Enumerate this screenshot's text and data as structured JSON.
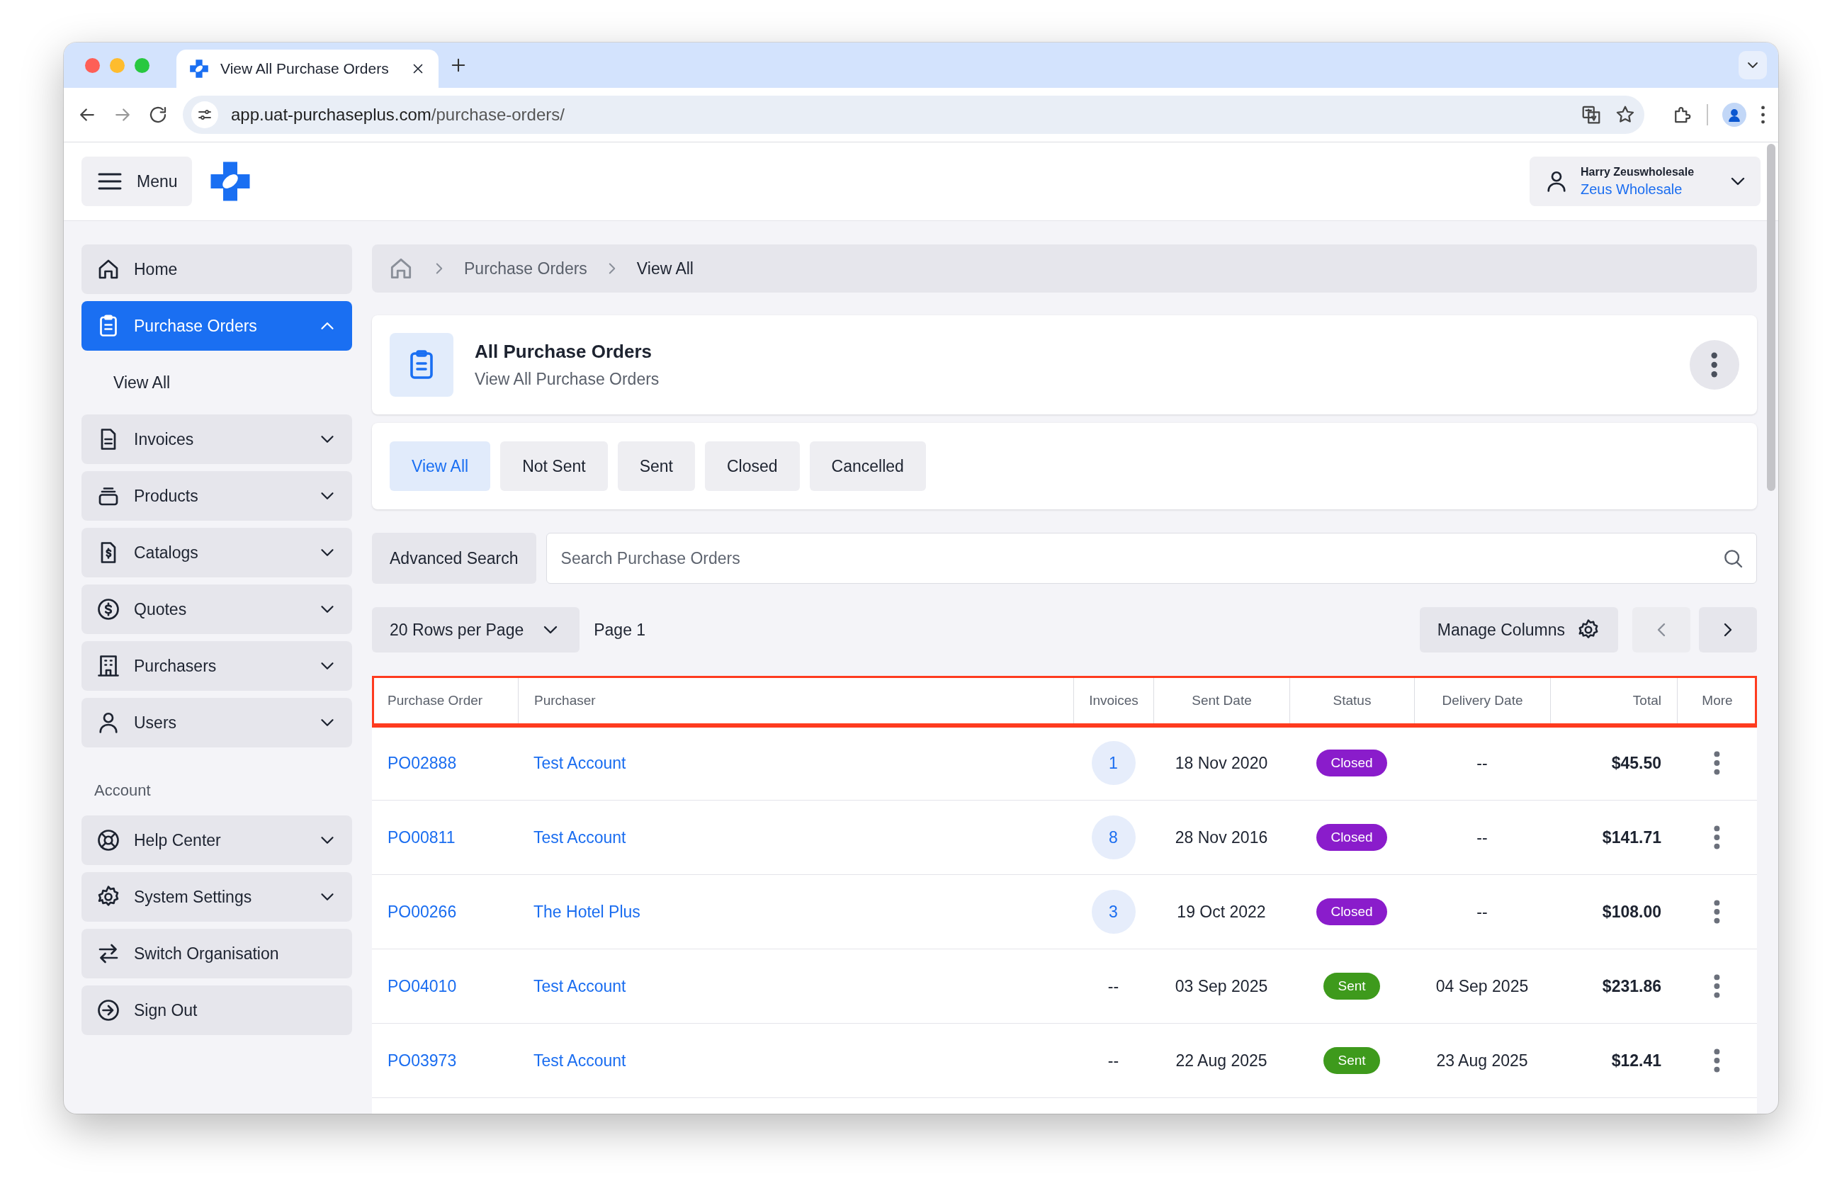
{
  "browser": {
    "tab_title": "View All Purchase Orders",
    "url_host": "app.uat-purchaseplus.com",
    "url_path": "/purchase-orders/"
  },
  "header": {
    "menu_label": "Menu",
    "user_name": "Harry Zeuswholesale",
    "organisation": "Zeus Wholesale"
  },
  "sidebar": {
    "items": [
      {
        "label": "Home",
        "kind": "link",
        "selected": false
      },
      {
        "label": "Purchase Orders",
        "kind": "group",
        "selected": true,
        "expanded": true,
        "children": [
          {
            "label": "View All"
          }
        ]
      },
      {
        "label": "Invoices",
        "kind": "group",
        "selected": false,
        "expanded": false
      },
      {
        "label": "Products",
        "kind": "group",
        "selected": false,
        "expanded": false
      },
      {
        "label": "Catalogs",
        "kind": "group",
        "selected": false,
        "expanded": false
      },
      {
        "label": "Quotes",
        "kind": "group",
        "selected": false,
        "expanded": false
      },
      {
        "label": "Purchasers",
        "kind": "group",
        "selected": false,
        "expanded": false
      },
      {
        "label": "Users",
        "kind": "group",
        "selected": false,
        "expanded": false
      }
    ],
    "section_label": "Account",
    "account_items": [
      {
        "label": "Help Center",
        "kind": "group",
        "selected": false,
        "expanded": false
      },
      {
        "label": "System Settings",
        "kind": "group",
        "selected": false,
        "expanded": false
      },
      {
        "label": "Switch Organisation",
        "kind": "link",
        "selected": false
      },
      {
        "label": "Sign Out",
        "kind": "link",
        "selected": false
      }
    ]
  },
  "breadcrumb": [
    "Purchase Orders",
    "View All"
  ],
  "page_header": {
    "title": "All Purchase Orders",
    "subtitle": "View All Purchase Orders"
  },
  "filter_tabs": [
    {
      "label": "View All",
      "selected": true
    },
    {
      "label": "Not Sent",
      "selected": false
    },
    {
      "label": "Sent",
      "selected": false
    },
    {
      "label": "Closed",
      "selected": false
    },
    {
      "label": "Cancelled",
      "selected": false
    }
  ],
  "search": {
    "button": "Advanced Search",
    "placeholder": "Search Purchase Orders"
  },
  "toolbar": {
    "rows_per_page": "20 Rows per Page",
    "page": "Page 1",
    "manage_columns": "Manage Columns",
    "prev_disabled": true
  },
  "table": {
    "highlighted": true,
    "columns": [
      "Purchase Order",
      "Purchaser",
      "Invoices",
      "Sent Date",
      "Status",
      "Delivery Date",
      "Total",
      "More"
    ],
    "rows": [
      {
        "purchase_order": "PO02888",
        "purchaser": "Test Account",
        "invoices": {
          "text": "1",
          "kind": "badge"
        },
        "sent_date": "18 Nov 2020",
        "status": "Closed",
        "color": "#8a1ccb",
        "delivery_date": "--",
        "total": "$45.50"
      },
      {
        "purchase_order": "PO00811",
        "purchaser": "Test Account",
        "invoices": {
          "text": "8",
          "kind": "badge"
        },
        "sent_date": "28 Nov 2016",
        "status": "Closed",
        "color": "#8a1ccb",
        "delivery_date": "--",
        "total": "$141.71"
      },
      {
        "purchase_order": "PO00266",
        "purchaser": "The Hotel Plus",
        "invoices": {
          "text": "3",
          "kind": "badge"
        },
        "sent_date": "19 Oct 2022",
        "status": "Closed",
        "color": "#8a1ccb",
        "delivery_date": "--",
        "total": "$108.00"
      },
      {
        "purchase_order": "PO04010",
        "purchaser": "Test Account",
        "invoices": {
          "text": "--",
          "kind": "plain"
        },
        "sent_date": "03 Sep 2025",
        "status": "Sent",
        "color": "#3e9a1c",
        "delivery_date": "04 Sep 2025",
        "total": "$231.86"
      },
      {
        "purchase_order": "PO03973",
        "purchaser": "Test Account",
        "invoices": {
          "text": "--",
          "kind": "plain"
        },
        "sent_date": "22 Aug 2025",
        "status": "Sent",
        "color": "#3e9a1c",
        "delivery_date": "23 Aug 2025",
        "total": "$12.41"
      }
    ]
  }
}
